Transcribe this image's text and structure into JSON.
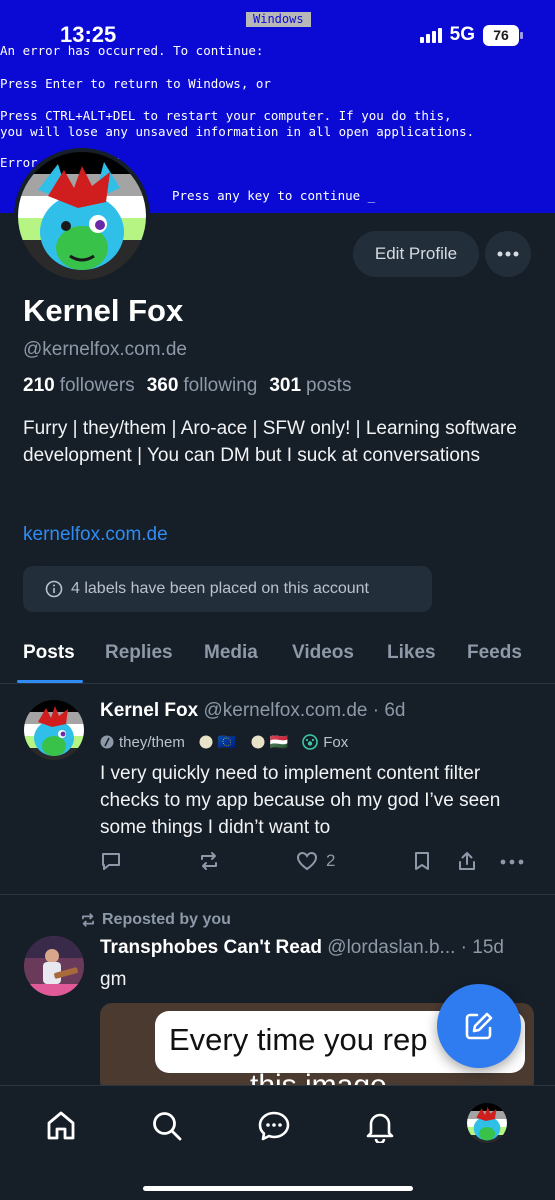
{
  "status_bar": {
    "time": "13:25",
    "network": "5G",
    "battery": "76"
  },
  "banner": {
    "window_title": "Windows",
    "lines": [
      "An error has occurred. To continue:",
      "Press Enter to return to Windows, or",
      "Press CTRL+ALT+DEL to restart your computer. If you do this,",
      "you will lose any unsaved information in all open applications.",
      "Error : BFF9B3D4",
      "Press any key to continue _"
    ]
  },
  "profile": {
    "display_name": "Kernel Fox",
    "handle": "@kernelfox.com.de",
    "edit_button": "Edit Profile",
    "followers_count": "210",
    "followers_label": "followers",
    "following_count": "360",
    "following_label": "following",
    "posts_count": "301",
    "posts_label": "posts",
    "bio": "Furry | they/them | Aro-ace | SFW only! | Learning software development | You can DM but I suck at conversations",
    "link": "kernelfox.com.de",
    "labels_notice": "4 labels have been placed on this account"
  },
  "tabs": [
    "Posts",
    "Replies",
    "Media",
    "Videos",
    "Likes",
    "Feeds"
  ],
  "active_tab": "Posts",
  "posts": [
    {
      "author": "Kernel Fox",
      "handle": "@kernelfox.com.de",
      "time": "· 6d",
      "badges": [
        "they/them",
        "🇪🇺",
        "🇭🇺",
        "Fox"
      ],
      "text": "I very quickly need to implement content filter checks to my app because oh my god I’ve seen some things I didn’t want to",
      "likes": "2"
    },
    {
      "repost_label": "Reposted by you",
      "author": "Transphobes Can't Read",
      "handle": "@lordaslan.b...",
      "time": "· 15d",
      "text": "gm",
      "embed_text": "Every time you rep",
      "embed_text_2": "this image"
    }
  ],
  "colors": {
    "accent": "#2f8cf5",
    "background": "#161e27",
    "banner": "#0a0ad4"
  }
}
